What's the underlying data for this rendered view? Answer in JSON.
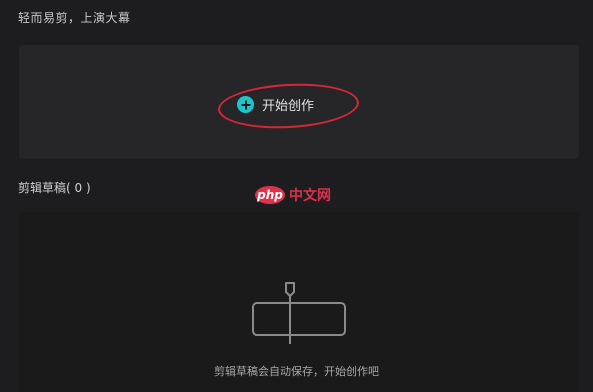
{
  "header": {
    "slogan": "轻而易剪，上演大幕"
  },
  "create": {
    "label": "开始创作",
    "icon": "plus-circle-icon",
    "accent_color": "#1fc4c8",
    "highlight_color": "#d7263a"
  },
  "drafts": {
    "title": "剪辑草稿( 0 )",
    "empty_hint": "剪辑草稿会自动保存，开始创作吧",
    "empty_icon": "timeline-clip-icon"
  },
  "watermark": {
    "badge": "php",
    "text": "中文网"
  }
}
